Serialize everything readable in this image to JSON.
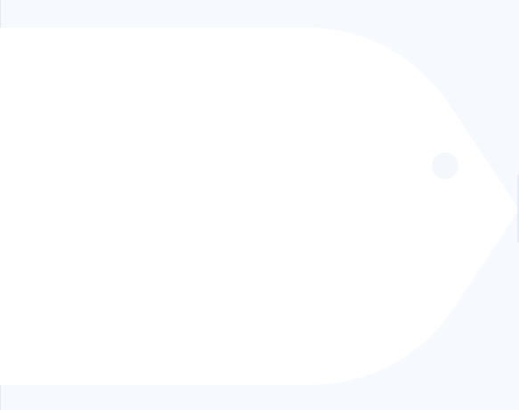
{
  "surface": {
    "background_color": "#f6f9fe",
    "tag_fill_color": "#ffffff",
    "hole_color": "#f4f7fc",
    "edge_color": "#e3e9f2"
  },
  "icon": {
    "name": "price-tag-icon"
  }
}
